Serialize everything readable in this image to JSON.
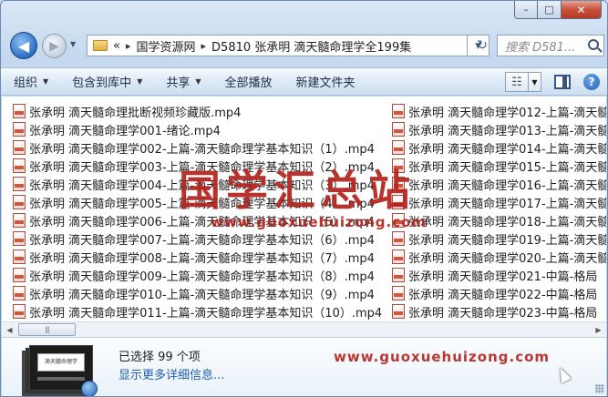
{
  "window": {
    "caption_min": "–",
    "caption_max": "□",
    "caption_close": "✕"
  },
  "address": {
    "chevrons": "«",
    "crumbs": [
      "国学资源网",
      "D5810 张承明 滴天髓命理学全199集"
    ],
    "separator": "▸",
    "end_arrow": "▾",
    "refresh": "↻"
  },
  "search": {
    "placeholder": "搜索 D581..."
  },
  "toolbar": {
    "organize": "组织",
    "include_library": "包含到库中",
    "share": "共享",
    "play_all": "全部播放",
    "new_folder": "新建文件夹",
    "caret": "▼",
    "view_icon": "☷",
    "help": "?"
  },
  "files": {
    "column1": [
      "张承明 滴天髓命理批断视频珍藏版.mp4",
      "张承明 滴天髓命理学001-绪论.mp4",
      "张承明 滴天髓命理学002-上篇-滴天髓命理学基本知识（1）.mp4",
      "张承明 滴天髓命理学003-上篇-滴天髓命理学基本知识（2）.mp4",
      "张承明 滴天髓命理学004-上篇-滴天髓命理学基本知识（3）.mp4",
      "张承明 滴天髓命理学005-上篇-滴天髓命理学基本知识（4）.mp4",
      "张承明 滴天髓命理学006-上篇-滴天髓命理学基本知识（5）.mp4",
      "张承明 滴天髓命理学007-上篇-滴天髓命理学基本知识（6）.mp4",
      "张承明 滴天髓命理学008-上篇-滴天髓命理学基本知识（7）.mp4",
      "张承明 滴天髓命理学009-上篇-滴天髓命理学基本知识（8）.mp4",
      "张承明 滴天髓命理学010-上篇-滴天髓命理学基本知识（9）.mp4",
      "张承明 滴天髓命理学011-上篇-滴天髓命理学基本知识（10）.mp4"
    ],
    "column2": [
      "张承明 滴天髓命理学012-上篇-滴天髓",
      "张承明 滴天髓命理学013-上篇-滴天髓",
      "张承明 滴天髓命理学014-上篇-滴天髓",
      "张承明 滴天髓命理学015-上篇-滴天髓",
      "张承明 滴天髓命理学016-上篇-滴天髓",
      "张承明 滴天髓命理学017-上篇-滴天髓",
      "张承明 滴天髓命理学018-上篇-滴天髓",
      "张承明 滴天髓命理学019-上篇-滴天髓",
      "张承明 滴天髓命理学020-上篇-滴天髓",
      "张承明 滴天髓命理学021-中篇-格局",
      "张承明 滴天髓命理学022-中篇-格局",
      "张承明 滴天髓命理学023-中篇-格局"
    ]
  },
  "watermark": {
    "text": "国学汇总站",
    "url": "www.guoxuehuizong.com"
  },
  "scrollbar": {
    "left_arrow": "◀",
    "right_arrow": "▶",
    "grip": "|||"
  },
  "details": {
    "selection": "已选择 99 个项",
    "more": "显示更多详细信息...",
    "thumb_label": "滴天髓命理学"
  },
  "colors": {
    "watermark": "#b4221c",
    "link": "#1f5db8"
  }
}
